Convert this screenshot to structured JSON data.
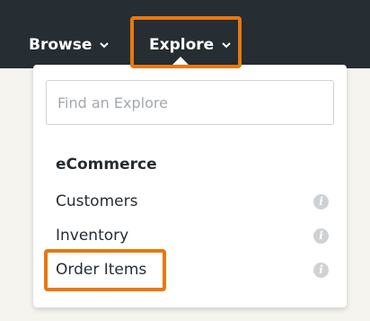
{
  "nav": {
    "browse_label": "Browse",
    "explore_label": "Explore"
  },
  "dropdown": {
    "search_placeholder": "Find an Explore",
    "group_title": "eCommerce",
    "items": [
      {
        "label": "Customers",
        "icon": "info-icon"
      },
      {
        "label": "Inventory",
        "icon": "info-icon"
      },
      {
        "label": "Order Items",
        "icon": "info-icon"
      }
    ]
  },
  "colors": {
    "topbar": "#262d33",
    "highlight": "#e8780f",
    "background": "#f5f4ef"
  }
}
